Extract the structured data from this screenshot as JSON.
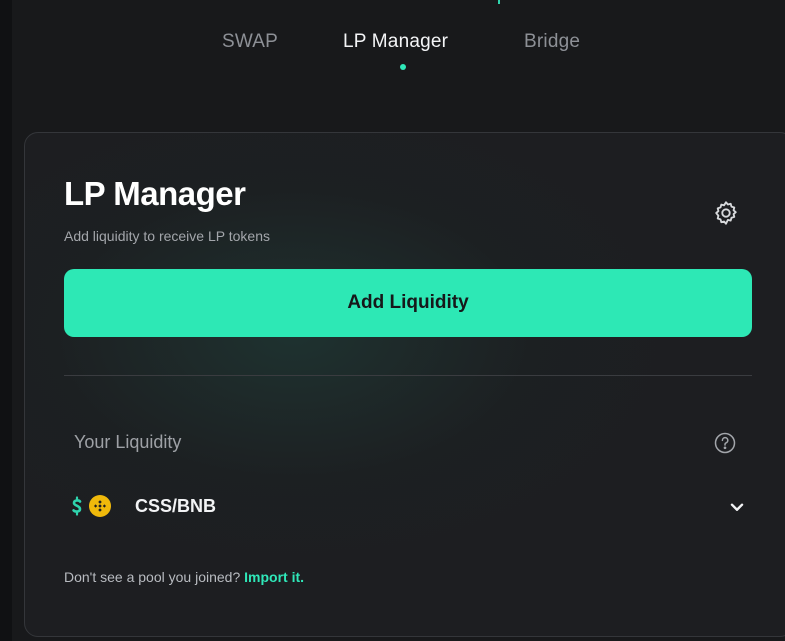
{
  "tabs": [
    {
      "label": "SWAP",
      "active": false
    },
    {
      "label": "LP Manager",
      "active": true
    },
    {
      "label": "Bridge",
      "active": false
    }
  ],
  "card": {
    "title": "LP Manager",
    "subtitle": "Add liquidity to receive LP tokens",
    "settings_icon": "gear-icon",
    "add_button_label": "Add Liquidity",
    "your_liquidity_label": "Your Liquidity",
    "help_icon": "question-circle-icon",
    "pools": [
      {
        "name": "CSS/BNB",
        "icons": [
          "css-token-icon",
          "bnb-token-icon"
        ],
        "expand_icon": "chevron-down-icon"
      }
    ],
    "import_text": "Don't see a pool you joined?",
    "import_link": "Import it."
  },
  "colors": {
    "accent": "#2de8b5",
    "background": "#18191b",
    "card": "#1d1e21",
    "bnb": "#f0b90b"
  }
}
